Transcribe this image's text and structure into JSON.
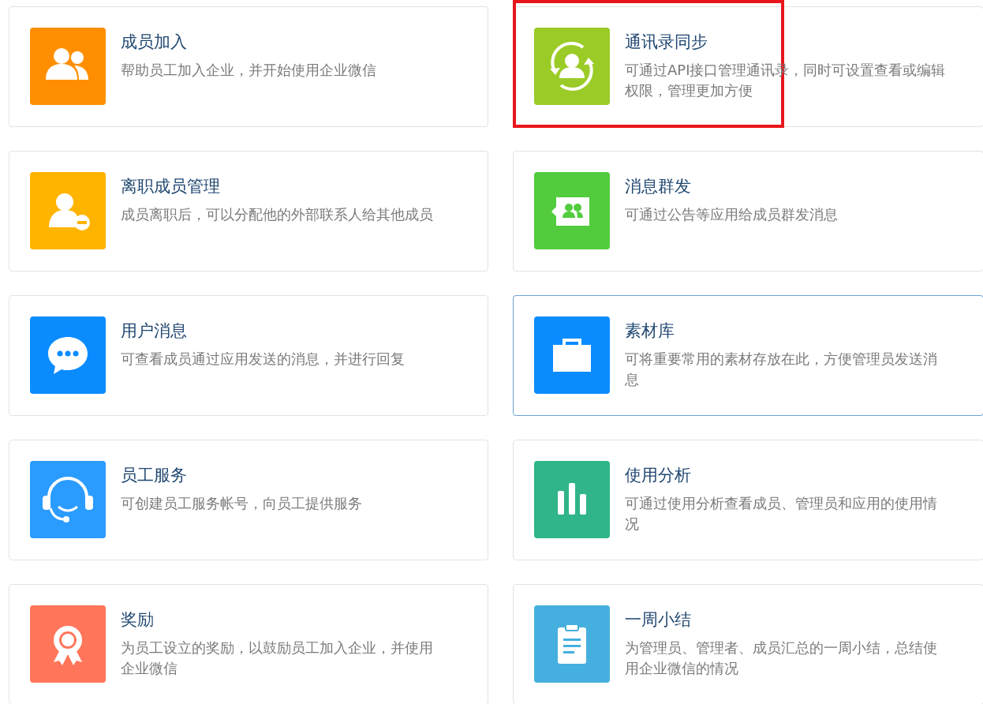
{
  "cards": [
    {
      "title": "成员加入",
      "description": "帮助员工加入企业，并开始使用企业微信",
      "kind": "members",
      "color": "#ff8f00",
      "hovered": false,
      "highlighted": false
    },
    {
      "title": "通讯录同步",
      "description": "可通过API接口管理通讯录，同时可设置查看或编辑权限，管理更加方便",
      "kind": "sync",
      "color": "#9bcb27",
      "hovered": false,
      "highlighted": true
    },
    {
      "title": "离职成员管理",
      "description": "成员离职后，可以分配他的外部联系人给其他成员",
      "kind": "leave",
      "color": "#ffb400",
      "hovered": false,
      "highlighted": false
    },
    {
      "title": "消息群发",
      "description": "可通过公告等应用给成员群发消息",
      "kind": "broadcast",
      "color": "#52cc3d",
      "hovered": false,
      "highlighted": false
    },
    {
      "title": "用户消息",
      "description": "可查看成员通过应用发送的消息，并进行回复",
      "kind": "chat",
      "color": "#0a8cff",
      "hovered": false,
      "highlighted": false
    },
    {
      "title": "素材库",
      "description": "可将重要常用的素材存放在此，方便管理员发送消息",
      "kind": "case",
      "color": "#0a8cff",
      "hovered": true,
      "highlighted": false
    },
    {
      "title": "员工服务",
      "description": "可创建员工服务帐号，向员工提供服务",
      "kind": "headset",
      "color": "#2a9bff",
      "hovered": false,
      "highlighted": false
    },
    {
      "title": "使用分析",
      "description": "可通过使用分析查看成员、管理员和应用的使用情况",
      "kind": "bars",
      "color": "#30b489",
      "hovered": false,
      "highlighted": false
    },
    {
      "title": "奖励",
      "description": "为员工设立的奖励，以鼓励员工加入企业，并使用企业微信",
      "kind": "award",
      "color": "#ff765a",
      "hovered": false,
      "highlighted": false
    },
    {
      "title": "一周小结",
      "description": "为管理员、管理者、成员汇总的一周小结，总结使用企业微信的情况",
      "kind": "clipboard",
      "color": "#45b0df",
      "hovered": false,
      "highlighted": false
    }
  ]
}
